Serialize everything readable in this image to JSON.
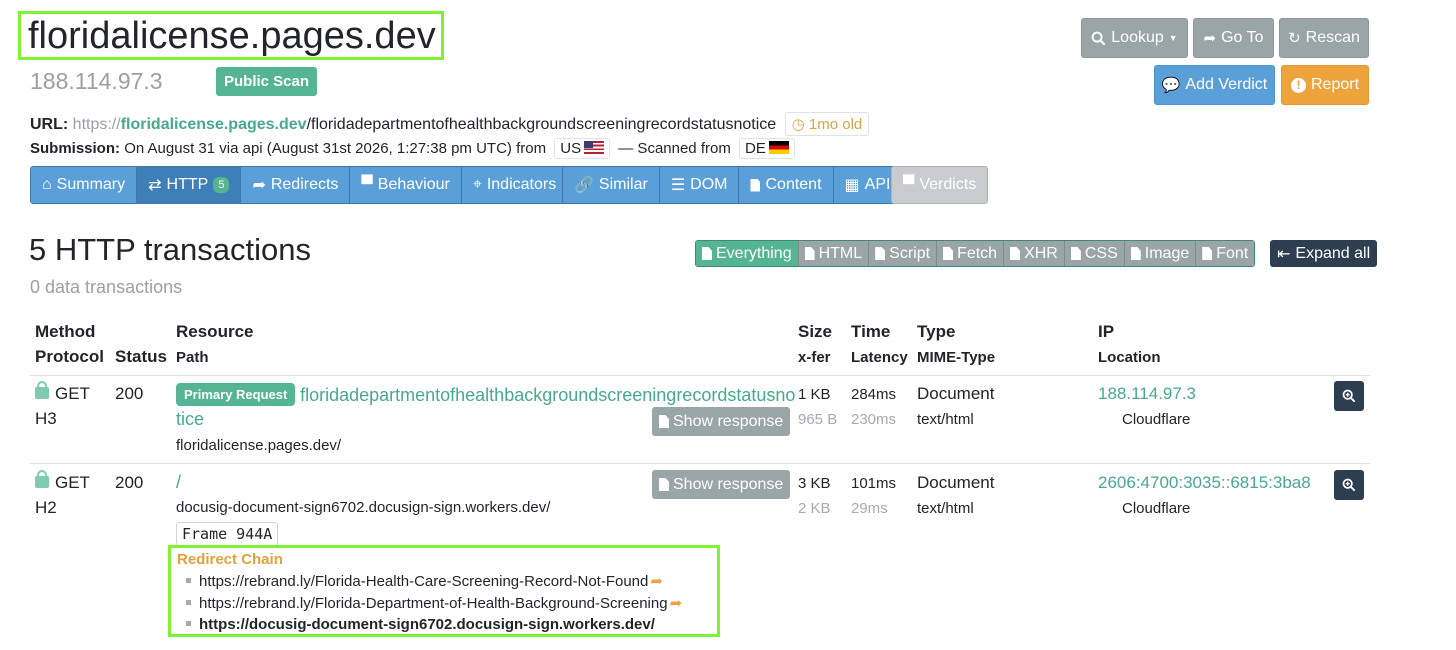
{
  "header": {
    "domain": "floridalicense.pages.dev",
    "ip": "188.114.97.3",
    "public_badge": "Public Scan"
  },
  "actions": {
    "lookup": "Lookup",
    "goto": "Go To",
    "rescan": "Rescan",
    "add_verdict": "Add Verdict",
    "report": "Report"
  },
  "meta": {
    "url_label": "URL:",
    "url_scheme": "https://",
    "url_host": "floridalicense.pages.dev",
    "url_path": "/floridadepartmentofhealthbackgroundscreeningrecordstatusnotice",
    "age": "1mo old",
    "submission_label": "Submission:",
    "submission_text": "On August 31 via api (August 31st 2026, 1:27:38 pm UTC) from",
    "submission_cc": "US",
    "scanned_from_text": "— Scanned from",
    "scanned_cc": "DE"
  },
  "tabs": {
    "group1": [
      {
        "label": "Summary",
        "icon": "home-icon"
      },
      {
        "label": "HTTP",
        "icon": "exchange-icon",
        "count": "5",
        "active": true
      },
      {
        "label": "Redirects",
        "icon": "share-icon"
      },
      {
        "label": "Behaviour",
        "icon": "comment-icon"
      },
      {
        "label": "Indicators",
        "icon": "crosshair-icon"
      }
    ],
    "group2": [
      {
        "label": "Similar",
        "icon": "link-icon"
      },
      {
        "label": "DOM",
        "icon": "list-icon"
      },
      {
        "label": "Content",
        "icon": "file-icon"
      },
      {
        "label": "API",
        "icon": "qrcode-icon"
      }
    ],
    "verdicts": "Verdicts"
  },
  "section": {
    "title": "5 HTTP transactions",
    "subtitle": "0 data transactions"
  },
  "filters": {
    "items": [
      "Everything",
      "HTML",
      "Script",
      "Fetch",
      "XHR",
      "CSS",
      "Image",
      "Font"
    ],
    "active": "Everything",
    "expand_all": "Expand all"
  },
  "table": {
    "headers": {
      "method": "Method",
      "protocol": "Protocol",
      "status": "Status",
      "resource": "Resource",
      "path": "Path",
      "size": "Size",
      "xfer": "x-fer",
      "time": "Time",
      "latency": "Latency",
      "type": "Type",
      "mime": "MIME-Type",
      "ip": "IP",
      "location": "Location"
    },
    "rows": [
      {
        "method": "GET",
        "protocol": "H3",
        "status": "200",
        "primary_badge": "Primary Request",
        "resource_line1": "floridadepartmentofhealthbackgroundscreeningrecordstatusno",
        "resource_line2": "tice",
        "path": "floridalicense.pages.dev/",
        "show_response": "Show response",
        "size": "1 KB",
        "xfer": "965 B",
        "time": "284ms",
        "latency": "230ms",
        "type": "Document",
        "mime": "text/html",
        "ip": "188.114.97.3",
        "location": "Cloudflare"
      },
      {
        "method": "GET",
        "protocol": "H2",
        "status": "200",
        "resource": "/",
        "path": "docusig-document-sign6702.docusign-sign.workers.dev/",
        "frame": "Frame 944A",
        "show_response": "Show response",
        "size": "3 KB",
        "xfer": "2 KB",
        "time": "101ms",
        "latency": "29ms",
        "type": "Document",
        "mime": "text/html",
        "ip": "2606:4700:3035::6815:3ba8",
        "location": "Cloudflare",
        "redirect_title": "Redirect Chain",
        "redirects": [
          "https://rebrand.ly/Florida-Health-Care-Screening-Record-Not-Found",
          "https://rebrand.ly/Florida-Department-of-Health-Background-Screening",
          "https://docusig-document-sign6702.docusign-sign.workers.dev/"
        ]
      }
    ]
  },
  "colors": {
    "accent_green": "#55b592",
    "link_green": "#48a98c",
    "tab_blue": "#5a9fd8",
    "highlight": "#7ff232",
    "orange": "#eda43c",
    "dark": "#2c3e50"
  }
}
